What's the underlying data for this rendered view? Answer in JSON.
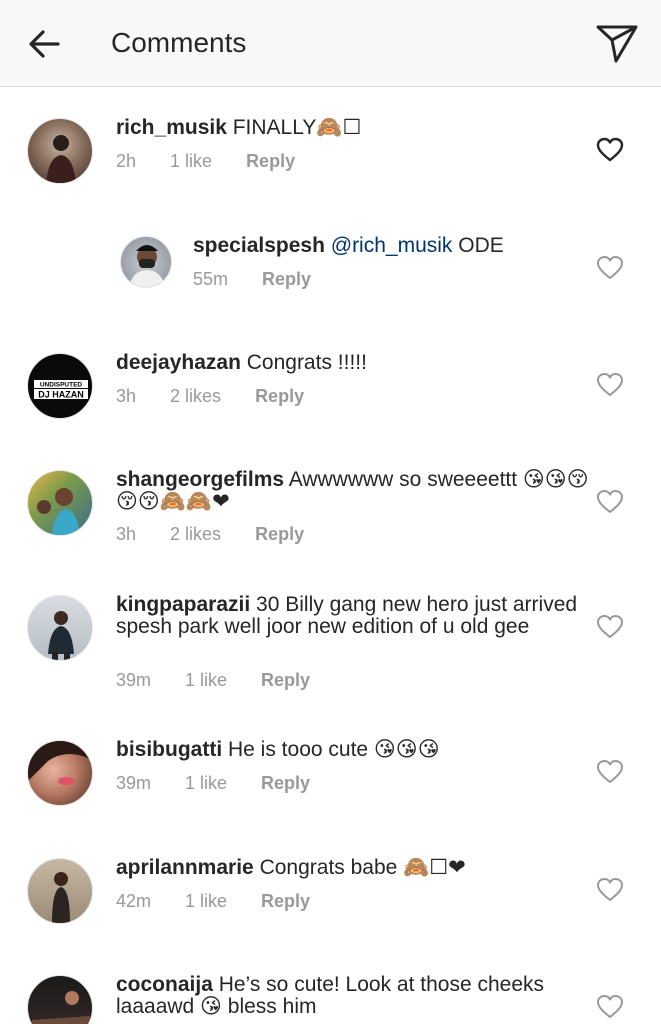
{
  "header": {
    "title": "Comments"
  },
  "comments": [
    {
      "user": "rich_musik",
      "text": " FINALLY🙈☐",
      "mention": "",
      "time": "2h",
      "likes": "1 like",
      "reply": "Reply",
      "liked_icon": "heart-outline-dark"
    },
    {
      "user": "specialspesh",
      "mention": "@rich_musik",
      "text": " ODE",
      "time": "55m",
      "likes": "",
      "reply": "Reply",
      "liked_icon": "heart-outline"
    },
    {
      "user": "deejayhazan",
      "text": " Congrats !!!!!",
      "mention": "",
      "time": "3h",
      "likes": "2 likes",
      "reply": "Reply",
      "liked_icon": "heart-outline"
    },
    {
      "user": "shangeorgefilms",
      "text": " Awwwwww so sweeeettt 😘😘😚😚😚🙈🙈❤",
      "mention": "",
      "time": "3h",
      "likes": "2 likes",
      "reply": "Reply",
      "liked_icon": "heart-outline"
    },
    {
      "user": "kingpaparazii",
      "text": " 30 Billy gang new hero just arrived spesh park well joor new edition of u old gee",
      "mention": "",
      "time": "39m",
      "likes": "1 like",
      "reply": "Reply",
      "liked_icon": "heart-outline"
    },
    {
      "user": "bisibugatti",
      "text": " He is tooo cute 😘😘😘",
      "mention": "",
      "time": "39m",
      "likes": "1 like",
      "reply": "Reply",
      "liked_icon": "heart-outline"
    },
    {
      "user": "aprilannmarie",
      "text": " Congrats babe 🙈☐❤",
      "mention": "",
      "time": "42m",
      "likes": "1 like",
      "reply": "Reply",
      "liked_icon": "heart-outline"
    },
    {
      "user": "coconaija",
      "text": " He’s so cute! Look at those cheeks laaaawd 😘 bless him",
      "mention": "",
      "time": "",
      "likes": "",
      "reply": "",
      "liked_icon": "heart-outline"
    }
  ],
  "avatar_badge": {
    "line1": "UNDISPUTED",
    "line2": "DJ HAZAN"
  },
  "colors": {
    "header_bg": "#f8f8f8",
    "text": "#262626",
    "meta": "#999999",
    "mention": "#003569"
  }
}
